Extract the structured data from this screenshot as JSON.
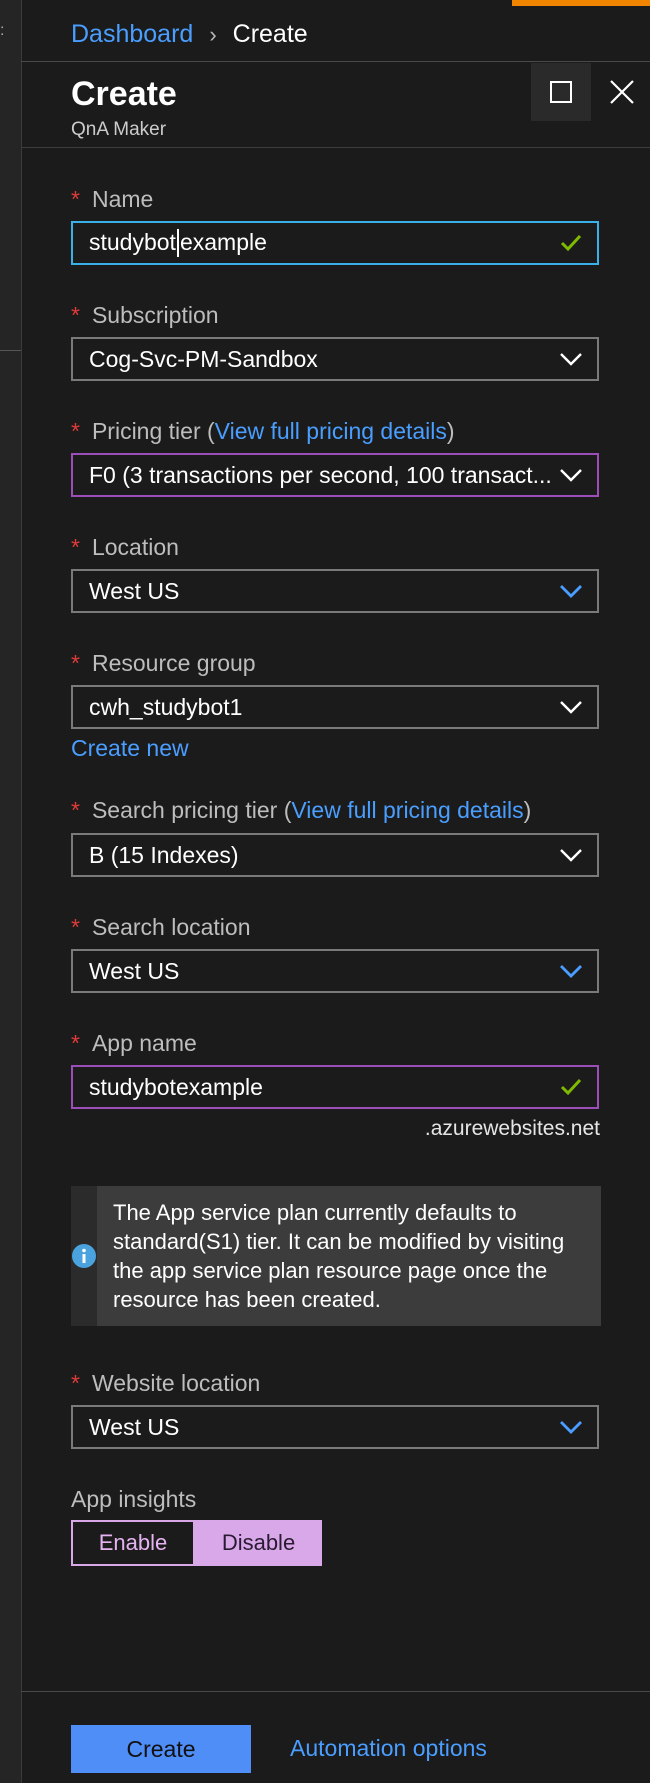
{
  "breadcrumb": {
    "root": "Dashboard",
    "separator": "›",
    "current": "Create"
  },
  "blade": {
    "title": "Create",
    "subtitle": "QnA Maker"
  },
  "form": {
    "required_marker": "*",
    "name": {
      "label": "Name",
      "value_before_cursor": "studybot",
      "value_after_cursor": "example",
      "icon": "checkmark-icon"
    },
    "subscription": {
      "label": "Subscription",
      "value": "Cog-Svc-PM-Sandbox",
      "icon": "chevron-down-icon"
    },
    "pricing_tier": {
      "label_prefix": "Pricing tier (",
      "link": "View full pricing details",
      "label_suffix": ")",
      "value": "F0 (3 transactions per second, 100 transact...",
      "icon": "chevron-down-icon"
    },
    "location": {
      "label": "Location",
      "value": "West US",
      "icon": "chevron-down-icon"
    },
    "resource_group": {
      "label": "Resource group",
      "value": "cwh_studybot1",
      "create_new": "Create new",
      "icon": "chevron-down-icon"
    },
    "search_pricing_tier": {
      "label_prefix": "Search pricing tier (",
      "link": "View full pricing details",
      "label_suffix": ")",
      "value": "B (15 Indexes)",
      "icon": "chevron-down-icon"
    },
    "search_location": {
      "label": "Search location",
      "value": "West US",
      "icon": "chevron-down-icon"
    },
    "app_name": {
      "label": "App name",
      "value": "studybotexample",
      "suffix": ".azurewebsites.net",
      "icon": "checkmark-icon"
    },
    "info": {
      "text": "The App service plan currently defaults to standard(S1) tier. It can be modified by visiting the app service plan resource page once the resource has been created.",
      "icon": "info-icon"
    },
    "website_location": {
      "label": "Website location",
      "value": "West US",
      "icon": "chevron-down-icon"
    },
    "app_insights": {
      "label": "App insights",
      "options": [
        "Enable",
        "Disable"
      ],
      "selected": "Disable"
    }
  },
  "footer": {
    "create": "Create",
    "automation": "Automation options"
  },
  "colors": {
    "accent_link": "#4a9eff",
    "required": "#e13a3a",
    "valid_check": "#7fba00",
    "toggle_selected": "#d9a8e8",
    "primary_button": "#4f8df7",
    "top_accent": "#f28500"
  }
}
